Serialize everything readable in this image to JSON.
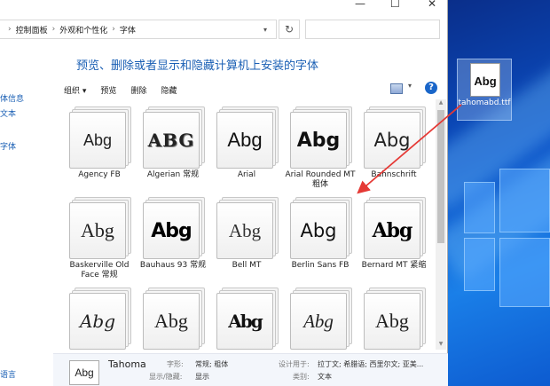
{
  "window": {
    "controls": {
      "minimize": "—",
      "maximize": "☐",
      "close": "✕"
    },
    "breadcrumb": [
      "控制面板",
      "外观和个性化",
      "字体"
    ],
    "refresh_icon": "refresh-icon",
    "nav_items": [
      "体信息",
      "文本",
      "字体",
      "语言"
    ],
    "heading": "预览、删除或者显示和隐藏计算机上安装的字体",
    "toolbar": {
      "organize": "组织",
      "organize_caret": "▾",
      "preview": "预览",
      "delete": "删除",
      "hide": "隐藏",
      "view_caret": "▾",
      "help": "?"
    }
  },
  "fonts": [
    {
      "sample": "Abg",
      "label": "Agency FB",
      "color": "#222"
    },
    {
      "sample": "ABG",
      "label": "Algerian 常规",
      "color": "#222"
    },
    {
      "sample": "Abg",
      "label": "Arial",
      "color": "#111"
    },
    {
      "sample": "Abg",
      "label": "Arial Rounded MT 粗体",
      "color": "#111"
    },
    {
      "sample": "Abg",
      "label": "Bahnschrift",
      "color": "#222"
    },
    {
      "sample": "Abg",
      "label": "Baskerville Old Face 常规",
      "color": "#222"
    },
    {
      "sample": "Abg",
      "label": "Bauhaus 93 常规",
      "color": "#000"
    },
    {
      "sample": "Abg",
      "label": "Bell MT",
      "color": "#333"
    },
    {
      "sample": "Abg",
      "label": "Berlin Sans FB",
      "color": "#111"
    },
    {
      "sample": "Abg",
      "label": "Bernard MT 紧缩",
      "color": "#000"
    },
    {
      "sample": "Abg",
      "label": "",
      "color": "#222"
    },
    {
      "sample": "Abg",
      "label": "",
      "color": "#222"
    },
    {
      "sample": "Abg",
      "label": "",
      "color": "#111"
    },
    {
      "sample": "Abg",
      "label": "",
      "color": "#222"
    },
    {
      "sample": "Abg",
      "label": "",
      "color": "#222"
    }
  ],
  "details": {
    "thumb": "Abg",
    "font_name": "Tahoma",
    "style_label": "字形:",
    "style_value": "常规; 粗体",
    "show_hide_label": "显示/隐藏:",
    "show_hide_value": "显示",
    "designed_for_label": "设计用于:",
    "designed_for_value": "拉丁文; 希腊语; 西里尔文; 亚美...",
    "category_label": "类别:",
    "category_value": "文本"
  },
  "desktop": {
    "file_icon_sample": "Abg",
    "file_name": "tahomabd.ttf"
  },
  "colors": {
    "accent": "#1a5fb4",
    "arrow": "#e53935"
  }
}
